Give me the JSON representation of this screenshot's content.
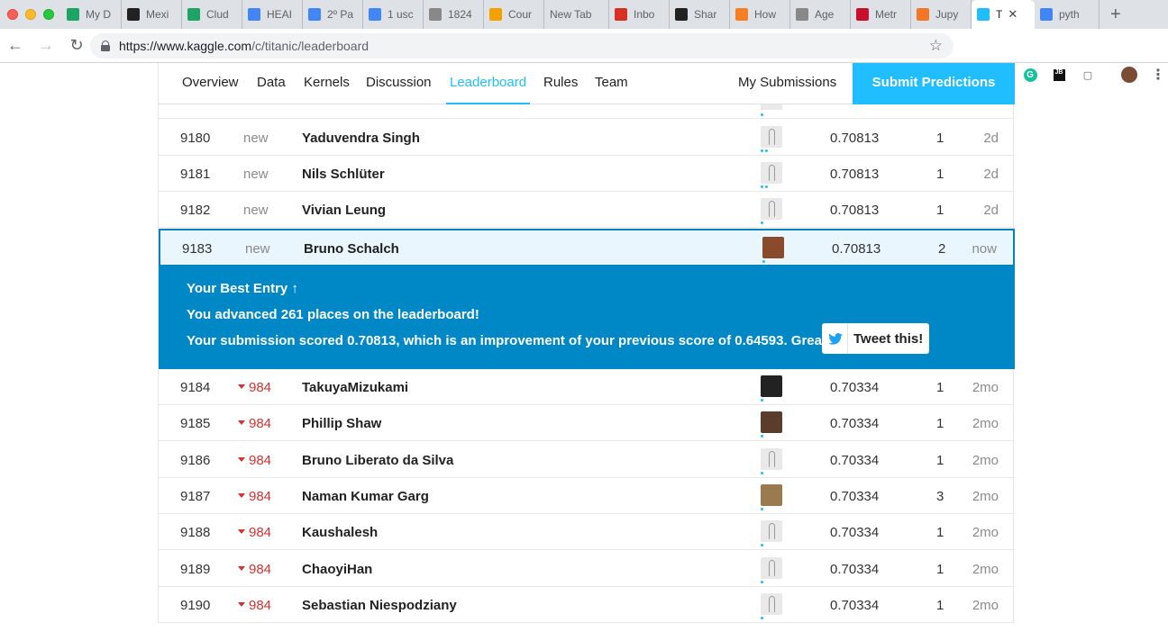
{
  "browser": {
    "tabs": [
      {
        "label": "My D",
        "icon": "google-drive-icon",
        "color": "#1fa463"
      },
      {
        "label": "Mexi",
        "icon": "te-icon",
        "color": "#222222"
      },
      {
        "label": "Clud",
        "icon": "google-drive-icon",
        "color": "#1fa463"
      },
      {
        "label": "HEAI",
        "icon": "google-docs-icon",
        "color": "#4285f4"
      },
      {
        "label": "2º Pa",
        "icon": "google-docs-icon",
        "color": "#4285f4"
      },
      {
        "label": "1 usc",
        "icon": "google-icon",
        "color": "#4285f4"
      },
      {
        "label": "1824",
        "icon": "document-icon",
        "color": "#888888"
      },
      {
        "label": "Cour",
        "icon": "pencil-icon",
        "color": "#f4a100"
      },
      {
        "label": "New Tab",
        "icon": "",
        "color": ""
      },
      {
        "label": "Inbo",
        "icon": "gmail-icon",
        "color": "#d93025"
      },
      {
        "label": "Shar",
        "icon": "github-icon",
        "color": "#222222"
      },
      {
        "label": "How",
        "icon": "stackoverflow-icon",
        "color": "#f48024"
      },
      {
        "label": "Age",
        "icon": "document-icon",
        "color": "#888888"
      },
      {
        "label": "Metr",
        "icon": "k-icon",
        "color": "#c8102e"
      },
      {
        "label": "Jupy",
        "icon": "jupyter-icon",
        "color": "#f37726"
      },
      {
        "label": "T",
        "icon": "kaggle-icon",
        "color": "#20beff",
        "active": true
      },
      {
        "label": "pyth",
        "icon": "google-icon",
        "color": "#4285f4"
      }
    ],
    "new_tab": "+",
    "url_host": "https://www.kaggle.com",
    "url_path": "/c/titanic/leaderboard"
  },
  "nav": {
    "links": [
      "Overview",
      "Data",
      "Kernels",
      "Discussion",
      "Leaderboard",
      "Rules",
      "Team"
    ],
    "my_submissions": "My Submissions",
    "submit": "Submit Predictions"
  },
  "rows_before": [
    {
      "rank": "9180",
      "delta": "new",
      "team": "Yaduvendra Singh",
      "score": "0.70813",
      "entries": "1",
      "last": "2d",
      "dots": 2
    },
    {
      "rank": "9181",
      "delta": "new",
      "team": "Nils Schlüter",
      "score": "0.70813",
      "entries": "1",
      "last": "2d",
      "dots": 2
    },
    {
      "rank": "9182",
      "delta": "new",
      "team": "Vivian Leung",
      "score": "0.70813",
      "entries": "1",
      "last": "2d",
      "dots": 1
    }
  ],
  "my_row": {
    "rank": "9183",
    "delta": "new",
    "team": "Bruno Schalch",
    "score": "0.70813",
    "entries": "2",
    "last": "now"
  },
  "banner": {
    "title": "Your Best Entry ↑",
    "advanced": "You advanced 261 places on the leaderboard!",
    "scored": "Your submission scored 0.70813, which is an improvement of your previous score of 0.64593. Great job!",
    "tweet": "Tweet this!"
  },
  "rows_after": [
    {
      "rank": "9184",
      "delta": "984",
      "team": "TakuyaMizukami",
      "score": "0.70334",
      "entries": "1",
      "last": "2mo",
      "avatar": "dark"
    },
    {
      "rank": "9185",
      "delta": "984",
      "team": "Phillip Shaw",
      "score": "0.70334",
      "entries": "1",
      "last": "2mo",
      "avatar": "photo"
    },
    {
      "rank": "9186",
      "delta": "984",
      "team": "Bruno Liberato da Silva",
      "score": "0.70334",
      "entries": "1",
      "last": "2mo",
      "avatar": "goose"
    },
    {
      "rank": "9187",
      "delta": "984",
      "team": "Naman Kumar Garg",
      "score": "0.70334",
      "entries": "3",
      "last": "2mo",
      "avatar": "photo"
    },
    {
      "rank": "9188",
      "delta": "984",
      "team": "Kaushalesh",
      "score": "0.70334",
      "entries": "1",
      "last": "2mo",
      "avatar": "goose"
    },
    {
      "rank": "9189",
      "delta": "984",
      "team": "ChaoyiHan",
      "score": "0.70334",
      "entries": "1",
      "last": "2mo",
      "avatar": "goose"
    },
    {
      "rank": "9190",
      "delta": "984",
      "team": "Sebastian Niespodziany",
      "score": "0.70334",
      "entries": "1",
      "last": "2mo",
      "avatar": "goose"
    }
  ],
  "colors": {
    "accent": "#20beff",
    "banner": "#0088c6",
    "down": "#d3312f"
  }
}
